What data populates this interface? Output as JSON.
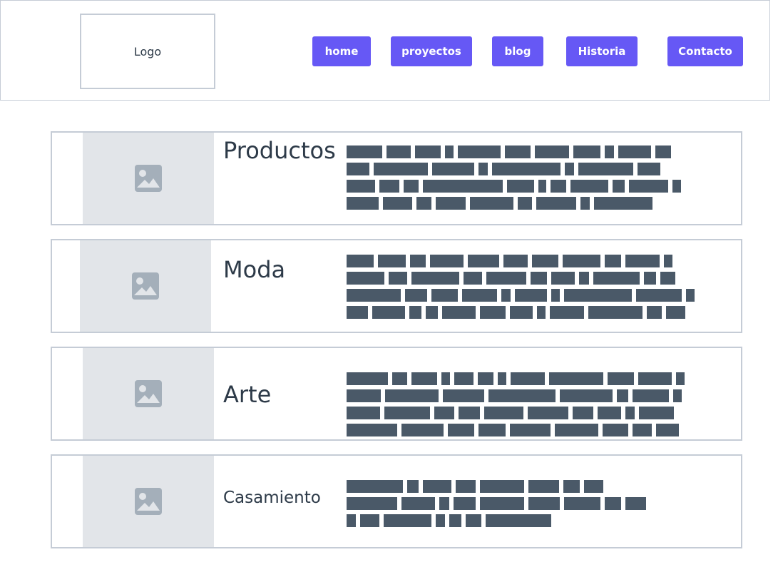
{
  "header": {
    "logo_text": "Logo",
    "nav": [
      {
        "label": "home"
      },
      {
        "label": "proyectos"
      },
      {
        "label": "blog"
      },
      {
        "label": "Historia"
      },
      {
        "label": "Contacto"
      }
    ]
  },
  "colors": {
    "accent": "#6658f5",
    "border": "#c5ccd6",
    "placeholder_bg": "#e2e5e9",
    "placeholder_icon": "#a4afba",
    "text_block": "#4a5968",
    "title_text": "#2d3a48"
  },
  "cards": [
    {
      "title": "Productos",
      "image_icon": "image-placeholder-icon"
    },
    {
      "title": "Moda",
      "image_icon": "image-placeholder-icon"
    },
    {
      "title": "Arte",
      "image_icon": "image-placeholder-icon"
    },
    {
      "title": "Casamiento",
      "image_icon": "image-placeholder-icon"
    }
  ]
}
